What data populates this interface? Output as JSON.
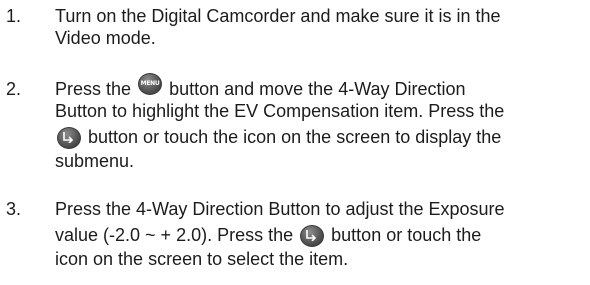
{
  "steps": [
    {
      "number": "1.",
      "line1": "Turn on the Digital Camcorder and make sure it is in the",
      "line2": "Video mode."
    },
    {
      "number": "2.",
      "line1_before": "Press the",
      "menu_icon_text": "MENU",
      "line1_after": "button and move the 4-Way Direction",
      "line2": "Button to highlight the EV Compensation item. Press the",
      "line3_after": "button or touch the icon on the screen to display the",
      "line4": "submenu."
    },
    {
      "number": "3.",
      "line1": "Press the 4-Way Direction Button to adjust the Exposure",
      "line2_before": "value (-2.0 ~ + 2.0). Press the",
      "line2_after": "button or touch the",
      "line3": "icon on the screen to select the item."
    }
  ],
  "icons": {
    "menu_button": "menu-button-icon",
    "ok_button": "ok-button-icon"
  }
}
